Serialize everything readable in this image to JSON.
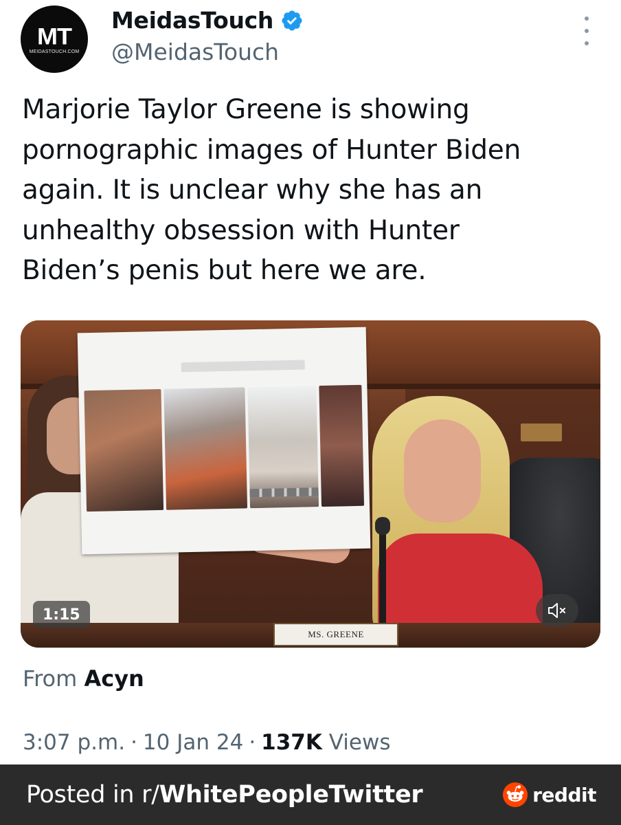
{
  "header": {
    "avatar_monogram": "MT",
    "avatar_site": "MEIDASTOUCH.COM",
    "display_name": "MeidasTouch",
    "handle": "@MeidasTouch",
    "verified_icon": "verified-badge-icon",
    "verified_color": "#1d9bf0",
    "more_icon": "more-vertical-icon"
  },
  "tweet": {
    "text": "Marjorie Taylor Greene is showing\npornographic images of Hunter Biden\nagain. It is unclear why she has an\nunhealthy obsession with Hunter\nBiden’s penis but here we are."
  },
  "media": {
    "duration": "1:15",
    "nameplate": "MS. GREENE",
    "mute_icon": "speaker-muted-icon"
  },
  "attribution": {
    "prefix": "From",
    "source": "Acyn"
  },
  "meta": {
    "time": "3:07 p.m.",
    "separator1": "·",
    "date": "10 Jan 24",
    "separator2": "·",
    "views_count": "137K",
    "views_label": "Views"
  },
  "footer": {
    "prefix": "Posted in r/",
    "subreddit": "WhitePeopleTwitter",
    "brand": "reddit",
    "brand_icon": "reddit-logo-icon",
    "bar_color": "#2b2b2b",
    "brand_color": "#ff4500"
  }
}
